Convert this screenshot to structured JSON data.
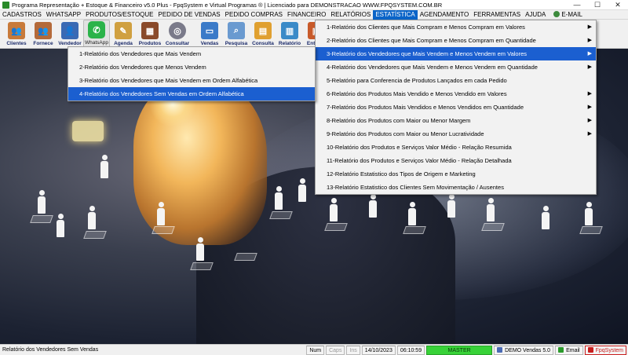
{
  "window": {
    "title": "Programa Representação + Estoque & Financeiro v5.0 Plus - FpqSystem e Virtual Programas ® | Licenciado para  DEMONSTRACAO WWW.FPQSYSTEM.COM.BR",
    "minimize": "—",
    "maximize": "☐",
    "close": "✕"
  },
  "menubar": {
    "items": [
      "CADASTROS",
      "WHATSAPP",
      "PRODUTOS/ESTOQUE",
      "PEDIDO DE VENDAS",
      "PEDIDO COMPRAS",
      "FINANCEIRO",
      "RELATÓRIOS",
      "ESTATÍSTICA",
      "AGENDAMENTO",
      "FERRAMENTAS",
      "AJUDA",
      "E-MAIL"
    ],
    "active": "ESTATÍSTICA"
  },
  "toolbar": {
    "buttons": [
      {
        "label": "Clientes",
        "icon": "clients-icon",
        "color": "#c87a3a",
        "glyph": "👥"
      },
      {
        "label": "Fornece",
        "icon": "supplier-icon",
        "color": "#b46a3a",
        "glyph": "👥"
      },
      {
        "label": "Vendedor",
        "icon": "seller-icon",
        "color": "#3a6ab4",
        "glyph": "👤"
      },
      {
        "label": "WhatsApp",
        "icon": "whatsapp-icon",
        "color": "#2bb34a",
        "glyph": "✆"
      },
      {
        "label": "Agenda",
        "icon": "agenda-icon",
        "color": "#d0a040",
        "glyph": "✎"
      },
      {
        "label": "Produtos",
        "icon": "products-icon",
        "color": "#8a4a2a",
        "glyph": "▦"
      },
      {
        "label": "Consultar",
        "icon": "consult-icon",
        "color": "#7a7a8a",
        "glyph": "◎"
      },
      {
        "label": "Vendas",
        "icon": "sales-icon",
        "color": "#3a7ac8",
        "glyph": "▭"
      },
      {
        "label": "Pesquisa",
        "icon": "search-icon",
        "color": "#6a9ad0",
        "glyph": "⌕"
      },
      {
        "label": "Consulta",
        "icon": "folder-icon",
        "color": "#e0a030",
        "glyph": "▤"
      },
      {
        "label": "Relatório",
        "icon": "report-icon",
        "color": "#3a8ac8",
        "glyph": "▥"
      },
      {
        "label": "Entrega",
        "icon": "delivery-icon",
        "color": "#c85a2a",
        "glyph": "▣"
      }
    ]
  },
  "estatistica_menu": {
    "items": [
      {
        "label": "1-Relatório dos Clientes que Mais Compram e Menos Compram em Valores",
        "submenu": true
      },
      {
        "label": "2-Relatório dos Clientes que Mais Compram e Menos Compram em Quantidade",
        "submenu": true
      },
      {
        "label": "3-Relatório dos Vendedores que Mais Vendem e Menos Vendem em Valores",
        "submenu": true
      },
      {
        "label": "4-Relatório dos Vendedores que Mais Vendem e Menos Vendem em Quantidade",
        "submenu": true
      },
      {
        "label": "5-Relatório para Conferencia de Produtos Lançados em cada Pedido",
        "submenu": false
      },
      {
        "label": "6-Relatório dos Produtos Mais Vendido e Menos Vendido em Valores",
        "submenu": true
      },
      {
        "label": "7-Relatório dos Produtos Mais Vendidos e Menos Vendidos em Quantidade",
        "submenu": true
      },
      {
        "label": "8-Relatório dos Produtos com Maior ou Menor Margem",
        "submenu": true
      },
      {
        "label": "9-Relatório dos Produtos com Maior ou Menor Lucratividade",
        "submenu": true
      },
      {
        "label": "10-Relatório dos Produtos e Serviços Valor Médio - Relação Resumida",
        "submenu": false
      },
      {
        "label": "11-Relatório dos Produtos e Serviços Valor Médio - Relação Detalhada",
        "submenu": false
      },
      {
        "label": "12-Relatório Estatistico dos Tipos de Origem e Marketing",
        "submenu": false
      },
      {
        "label": "13-Relatório Estatistico dos Clientes Sem Movimentação / Ausentes",
        "submenu": false
      }
    ],
    "selected_index": 2
  },
  "vendedores_submenu": {
    "items": [
      "1-Relatório dos Vendedores que Mais Vendem",
      "2-Relatório dos Vendedores que Menos Vendem",
      "3-Relatório dos Vendedores que Mais Vendem em Ordem Alfabética",
      "4-Relatório dos Vendedores Sem Vendas em Ordem Alfabética"
    ],
    "selected_index": 3
  },
  "statusbar": {
    "message": "Relatório dos Vendedores Sem Vendas",
    "num": "Num",
    "caps": "Caps",
    "ins": "Ins",
    "date": "14/10/2023",
    "time": "06:10:59",
    "db": "MASTER",
    "company": "DEMO Vendas 5.0",
    "email": "Email",
    "brand": "FpqSystem"
  }
}
